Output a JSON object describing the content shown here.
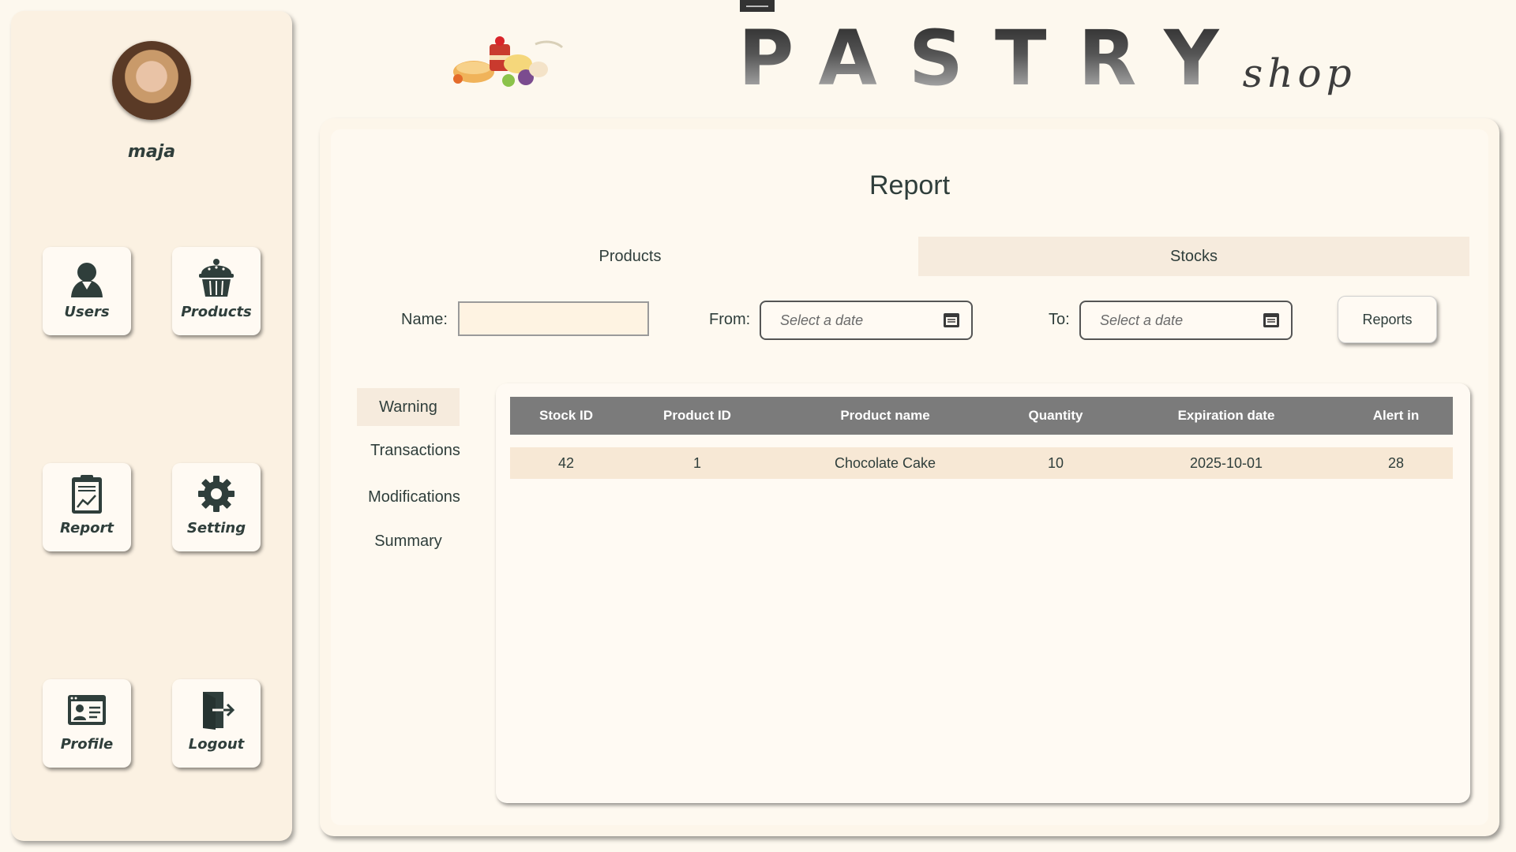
{
  "app": {
    "brand_word": "PASTRY",
    "brand_sub": "shop"
  },
  "sidebar": {
    "username": "maja",
    "items": [
      {
        "label": "Users",
        "icon": "user-icon"
      },
      {
        "label": "Products",
        "icon": "cupcake-icon"
      },
      {
        "label": "Report",
        "icon": "clipboard-chart-icon"
      },
      {
        "label": "Setting",
        "icon": "gear-icon"
      },
      {
        "label": "Profile",
        "icon": "id-card-icon"
      },
      {
        "label": "Logout",
        "icon": "logout-icon"
      }
    ]
  },
  "main": {
    "title": "Report",
    "tabs": [
      {
        "label": "Products",
        "active": true
      },
      {
        "label": "Stocks",
        "active": false
      }
    ],
    "filters": {
      "name_label": "Name:",
      "name_value": "",
      "from_label": "From:",
      "from_placeholder": "Select a date",
      "to_label": "To:",
      "to_placeholder": "Select a date",
      "reports_button": "Reports"
    },
    "report_types": [
      {
        "label": "Warning",
        "selected": true
      },
      {
        "label": "Transactions",
        "selected": false
      },
      {
        "label": "Modifications",
        "selected": false
      },
      {
        "label": "Summary",
        "selected": false
      }
    ],
    "table": {
      "columns": [
        "Stock ID",
        "Product ID",
        "Product name",
        "Quantity",
        "Expiration date",
        "Alert in"
      ],
      "rows": [
        [
          "42",
          "1",
          "Chocolate Cake",
          "10",
          "2025-10-01",
          "28"
        ]
      ]
    }
  },
  "colors": {
    "background": "#fdf8ee",
    "sidebar": "#fbf1e2",
    "header_row": "#7b7b7b",
    "data_row": "#f7e8d5",
    "text": "#2f3e3b"
  }
}
